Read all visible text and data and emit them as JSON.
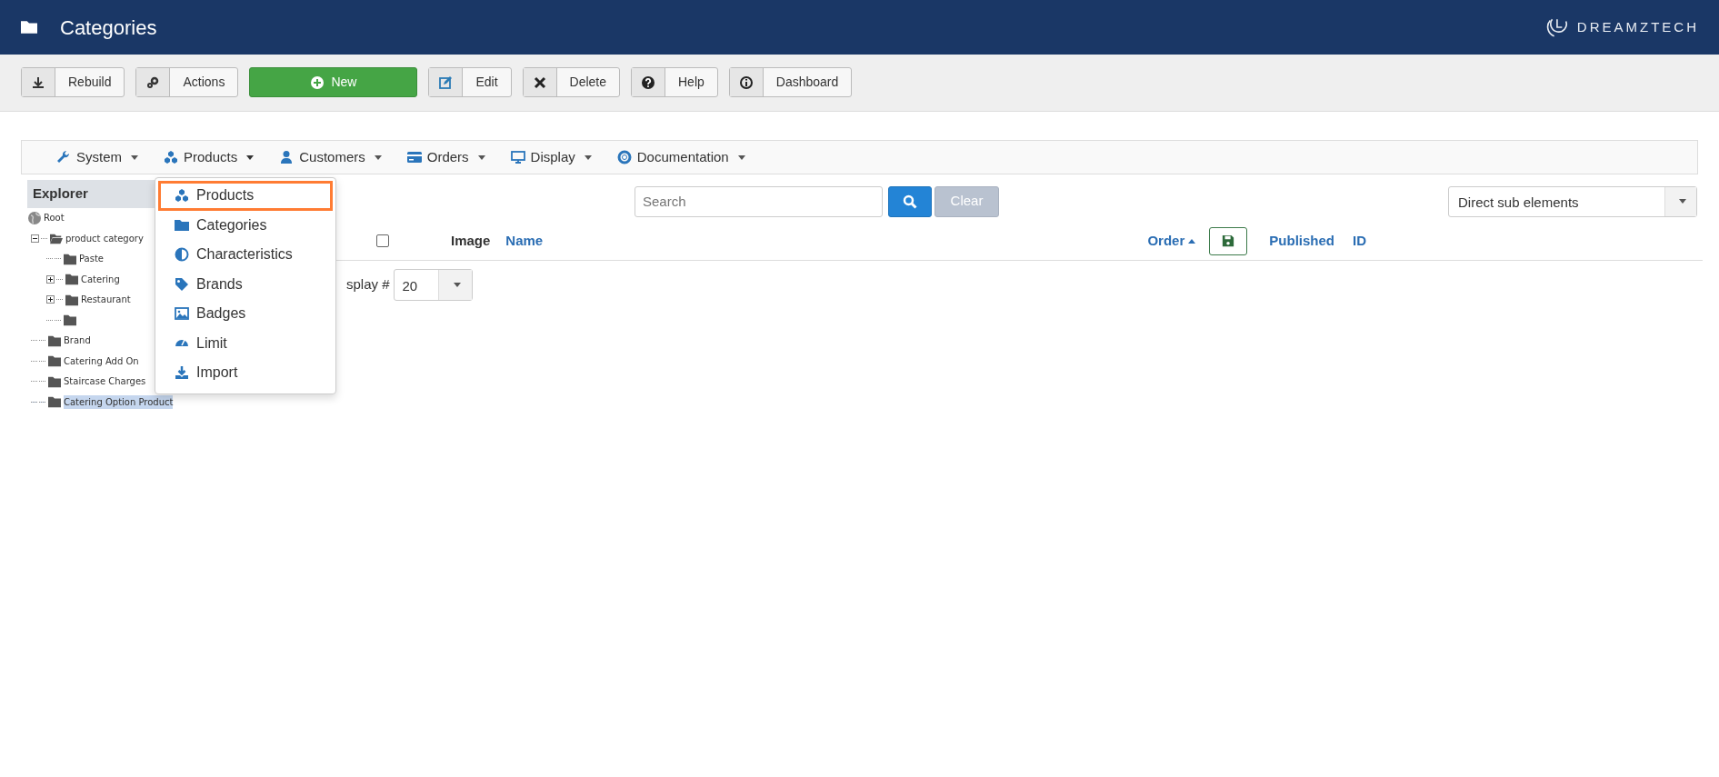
{
  "header": {
    "title": "Categories",
    "logo_text": "DREAMZTECH"
  },
  "toolbar": [
    {
      "label": "Rebuild",
      "kind": "split"
    },
    {
      "label": "Actions",
      "kind": "split"
    },
    {
      "label": "New",
      "kind": "primary"
    },
    {
      "label": "Edit",
      "kind": "split"
    },
    {
      "label": "Delete",
      "kind": "split"
    },
    {
      "label": "Help",
      "kind": "split"
    },
    {
      "label": "Dashboard",
      "kind": "split"
    }
  ],
  "menu": [
    {
      "label": "System",
      "expanded": false
    },
    {
      "label": "Products",
      "expanded": true,
      "items": [
        {
          "label": "Products",
          "selected": true
        },
        {
          "label": "Categories",
          "selected": false
        },
        {
          "label": "Characteristics",
          "selected": false
        },
        {
          "label": "Brands",
          "selected": false
        },
        {
          "label": "Badges",
          "selected": false
        },
        {
          "label": "Limit",
          "selected": false
        },
        {
          "label": "Import",
          "selected": false
        }
      ]
    },
    {
      "label": "Customers",
      "expanded": false
    },
    {
      "label": "Orders",
      "expanded": false
    },
    {
      "label": "Display",
      "expanded": false
    },
    {
      "label": "Documentation",
      "expanded": false
    }
  ],
  "explorer": {
    "title": "Explorer",
    "tree": [
      {
        "label": "Root",
        "kind": "root",
        "selected": false,
        "children": [
          {
            "label": "product category",
            "expanded": true,
            "selected": false,
            "children": [
              {
                "label": "Paste",
                "selected": false
              },
              {
                "label": "Catering",
                "expanded": false,
                "selected": false
              },
              {
                "label": "Restaurant",
                "expanded": false,
                "selected": false
              },
              {
                "selected": false
              }
            ]
          },
          {
            "label": "Brand",
            "selected": false
          },
          {
            "label": "Catering Add On",
            "selected": false
          },
          {
            "label": "Staircase Charges",
            "selected": false
          },
          {
            "label": "Catering Option Product",
            "selected": true
          }
        ]
      }
    ]
  },
  "filters": {
    "search": {
      "placeholder": "Search"
    },
    "clear_button": "Clear",
    "scope": "Direct sub elements"
  },
  "table": {
    "select_all": {
      "checked": false
    },
    "columns": [
      {
        "label": "Image",
        "kind": "plain"
      },
      {
        "label": "Name",
        "kind": "link"
      },
      {
        "label": "Order",
        "kind": "sorted"
      },
      {
        "kind": "save"
      },
      {
        "label": "Published",
        "kind": "link"
      },
      {
        "label": "ID",
        "kind": "link"
      }
    ]
  },
  "pagination": {
    "label": "splay #",
    "value": "20"
  }
}
